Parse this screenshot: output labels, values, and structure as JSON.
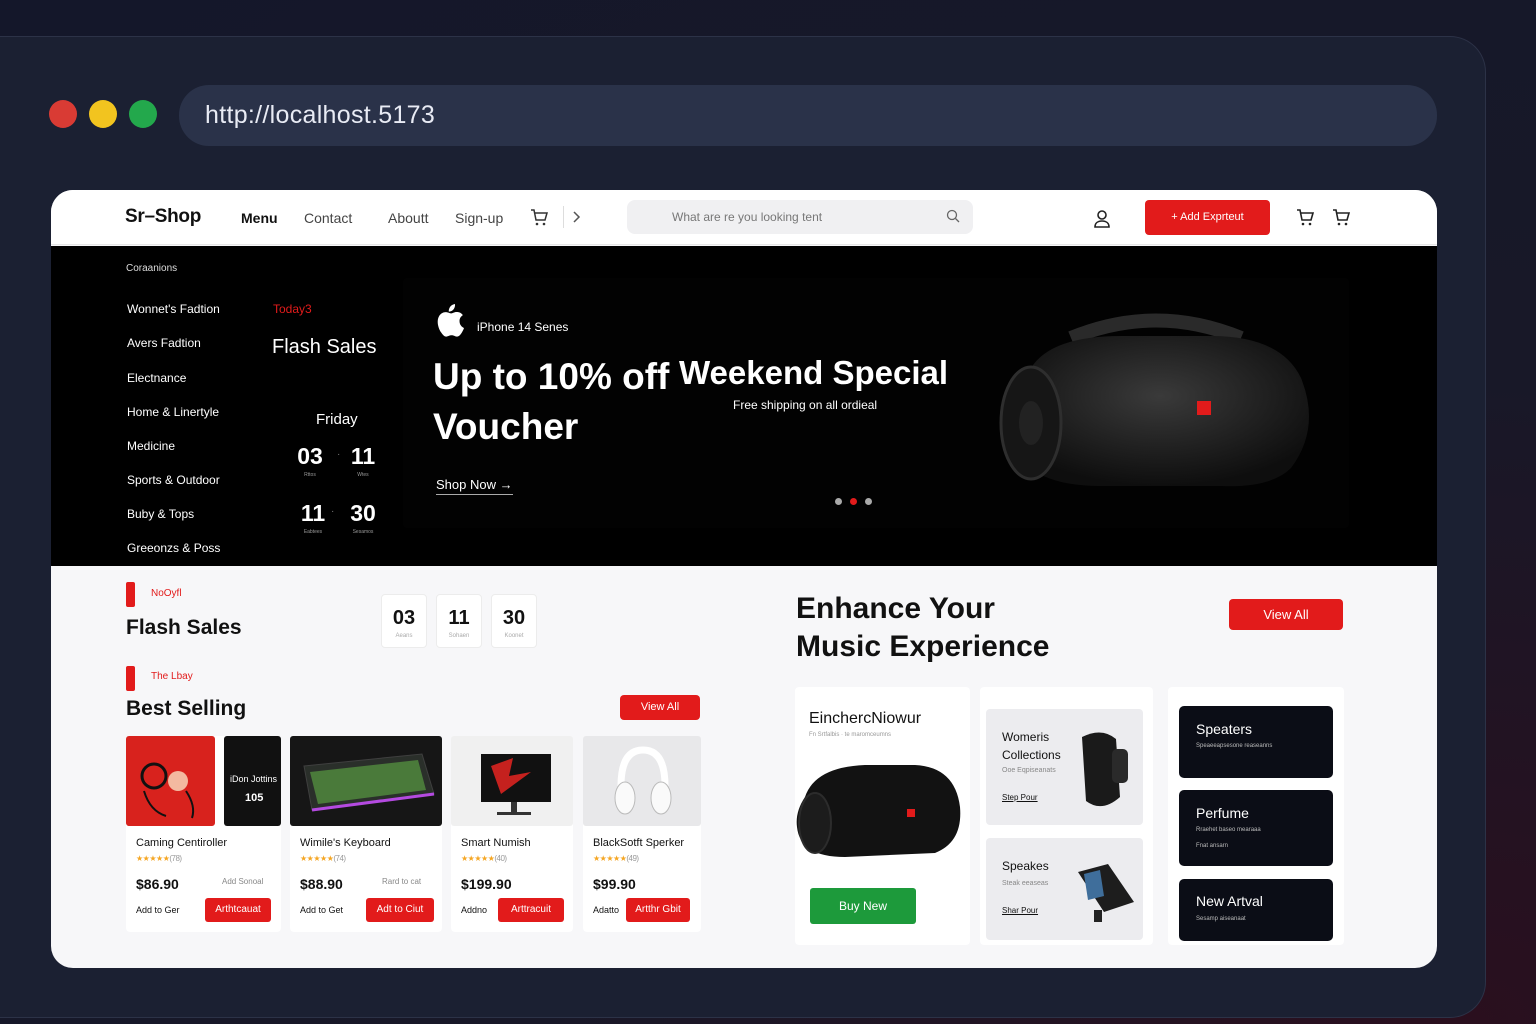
{
  "browser": {
    "url": "http://localhost.5173"
  },
  "header": {
    "logo": "Sr–Shop",
    "nav": [
      "Menu",
      "Contact",
      "Aboutt",
      "Sign-up"
    ],
    "search_placeholder": "What are re you looking tent",
    "add_button": "+ Add Exprteut"
  },
  "sidebar": {
    "title": "Coraanions",
    "categories": [
      "Wonnet's Fadtion",
      "Avers Fadtion",
      "Electnance",
      "Home & Linertyle",
      "Medicine",
      "Sports & Outdoor",
      "Buby & Tops",
      "Greeonzs & Poss"
    ]
  },
  "hero_flash": {
    "label": "Today3",
    "title": "Flash Sales",
    "day": "Friday",
    "countdown": [
      {
        "value": "03",
        "unit": "Rttos"
      },
      {
        "value": "11",
        "unit": "Wtes"
      },
      {
        "value": "11",
        "unit": "Eabtees"
      },
      {
        "value": "30",
        "unit": "Sesamos"
      }
    ]
  },
  "banner": {
    "product_line": "iPhone 14 Senes",
    "headline": "Up to 10% off Voucher",
    "cta": "Shop Now →",
    "special_title": "Weekend Special",
    "special_sub": "Free shipping on all ordieal",
    "slides": 3,
    "active_slide": 2
  },
  "flash_section": {
    "label": "NoOyfl",
    "title": "Flash Sales",
    "timer": [
      {
        "value": "03",
        "unit": "Aeans"
      },
      {
        "value": "11",
        "unit": "Sohaen"
      },
      {
        "value": "30",
        "unit": "Koonet"
      }
    ]
  },
  "best_selling": {
    "label": "The Lbay",
    "title": "Best Selling",
    "view_all": "View All",
    "promo_text": "iDon Jottins",
    "promo_num": "105",
    "products": [
      {
        "name": "Caming Centiroller",
        "stars": "★★★★★",
        "reviews": "(78)",
        "price": "$86.90",
        "alt": "Add Sonoal",
        "add": "Add to Ger",
        "cart": "Arthtcauat"
      },
      {
        "name": "Wimile's Keyboard",
        "stars": "★★★★★",
        "reviews": "(74)",
        "price": "$88.90",
        "alt": "Rard to cat",
        "add": "Add to Get",
        "cart": "Adt to Ciut"
      },
      {
        "name": "Smart Numish",
        "stars": "★★★★★",
        "reviews": "(40)",
        "price": "$199.90",
        "alt": "",
        "add": "Addno",
        "cart": "Arttracuit"
      },
      {
        "name": "BlackSotft Sperker",
        "stars": "★★★★★",
        "reviews": "(49)",
        "price": "$99.90",
        "alt": "",
        "add": "Adatto",
        "cart": "Artthr Gbit"
      }
    ]
  },
  "music": {
    "title_line1": "Enhance Your",
    "title_line2": "Music Experience",
    "view_all": "View All",
    "feature": {
      "title": "EinchercNiowur",
      "sub": "Fn Srtfalbis · te maromceumns",
      "button": "Buy New"
    },
    "mid_cards": [
      {
        "title": "Womeris Collections",
        "sub": "Ooe Eqpiseanats",
        "link": "Step Pour"
      },
      {
        "title": "Speakes",
        "sub": "Steak eeaseas",
        "link": "Shar Pour"
      }
    ],
    "dark_cards": [
      {
        "title": "Speaters",
        "sub": "Speaeeapsesone reaseanns"
      },
      {
        "title": "Perfume",
        "sub": "Rraehet baseo mearaaa",
        "sub2": "Fnat ansarn"
      },
      {
        "title": "New Artval",
        "sub": "Sesamp aiseanaat"
      }
    ]
  },
  "colors": {
    "accent": "#e21b1b",
    "buy": "#1d9a3b",
    "dark": "#0b0d16"
  }
}
